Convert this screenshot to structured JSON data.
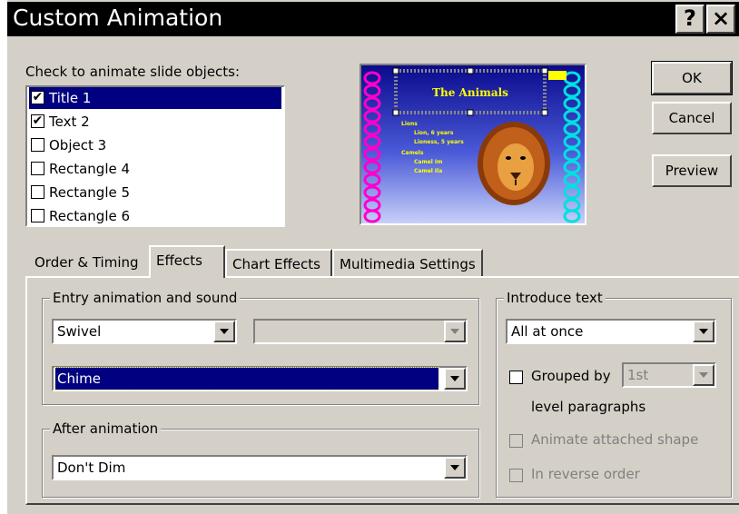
{
  "window": {
    "title": "Custom Animation",
    "help_glyph": "?",
    "close_glyph": "×"
  },
  "objects": {
    "label": "Check to animate slide objects:",
    "items": [
      {
        "label": "Title 1",
        "checked": true,
        "selected": true
      },
      {
        "label": "Text 2",
        "checked": true,
        "selected": false
      },
      {
        "label": "Object 3",
        "checked": false,
        "selected": false
      },
      {
        "label": "Rectangle 4",
        "checked": false,
        "selected": false
      },
      {
        "label": "Rectangle 5",
        "checked": false,
        "selected": false
      },
      {
        "label": "Rectangle 6",
        "checked": false,
        "selected": false
      }
    ]
  },
  "slide_preview": {
    "title": "The Animals",
    "bullets": [
      "Lions",
      "Lion, 6 years",
      "Lioness, 5 years",
      "Camels",
      "Camel Im",
      "Camel Ila"
    ]
  },
  "buttons": {
    "ok": "OK",
    "cancel": "Cancel",
    "preview": "Preview"
  },
  "tabs": [
    "Order & Timing",
    "Effects",
    "Chart Effects",
    "Multimedia Settings"
  ],
  "active_tab": "Effects",
  "entry": {
    "group_label": "Entry animation and sound",
    "effect_value": "Swivel",
    "direction_value": "",
    "sound_value": "Chime"
  },
  "after": {
    "group_label": "After animation",
    "value": "Don't Dim"
  },
  "introduce": {
    "group_label": "Introduce text",
    "value": "All at once",
    "grouped_by_label": "Grouped by",
    "grouped_by_value": "1st",
    "level_label": "level paragraphs",
    "animate_shape_label": "Animate attached shape",
    "reverse_label": "In reverse order"
  },
  "colors": {
    "selection": "#000080",
    "dialog": "#d4d0c8"
  }
}
